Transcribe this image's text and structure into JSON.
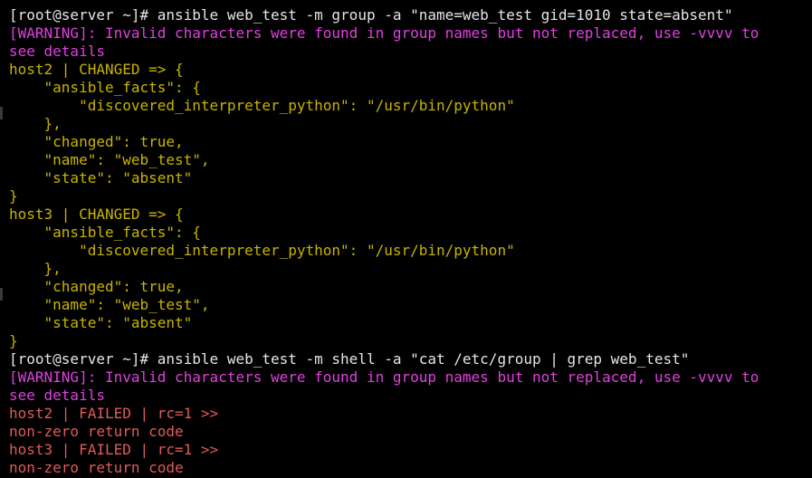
{
  "terminal": {
    "colors": {
      "background": "#000000",
      "prompt": "#e6e6e6",
      "warning": "#e040e0",
      "changed": "#c8b400",
      "failed": "#e05a5a"
    },
    "lines": [
      {
        "kind": "prompt",
        "text": "[root@server ~]# ansible web_test -m group -a \"name=web_test gid=1010 state=absent\""
      },
      {
        "kind": "warn",
        "text": "[WARNING]: Invalid characters were found in group names but not replaced, use -vvvv to"
      },
      {
        "kind": "warn",
        "text": "see details"
      },
      {
        "kind": "changed",
        "text": "host2 | CHANGED => {"
      },
      {
        "kind": "changed",
        "text": "    \"ansible_facts\": {"
      },
      {
        "kind": "changed",
        "text": "        \"discovered_interpreter_python\": \"/usr/bin/python\""
      },
      {
        "kind": "changed",
        "text": "    },"
      },
      {
        "kind": "changed",
        "text": "    \"changed\": true,"
      },
      {
        "kind": "changed",
        "text": "    \"name\": \"web_test\","
      },
      {
        "kind": "changed",
        "text": "    \"state\": \"absent\""
      },
      {
        "kind": "changed",
        "text": "}"
      },
      {
        "kind": "changed",
        "text": "host3 | CHANGED => {"
      },
      {
        "kind": "changed",
        "text": "    \"ansible_facts\": {"
      },
      {
        "kind": "changed",
        "text": "        \"discovered_interpreter_python\": \"/usr/bin/python\""
      },
      {
        "kind": "changed",
        "text": "    },"
      },
      {
        "kind": "changed",
        "text": "    \"changed\": true,"
      },
      {
        "kind": "changed",
        "text": "    \"name\": \"web_test\","
      },
      {
        "kind": "changed",
        "text": "    \"state\": \"absent\""
      },
      {
        "kind": "changed",
        "text": "}"
      },
      {
        "kind": "prompt",
        "text": "[root@server ~]# ansible web_test -m shell -a \"cat /etc/group | grep web_test\""
      },
      {
        "kind": "warn",
        "text": "[WARNING]: Invalid characters were found in group names but not replaced, use -vvvv to"
      },
      {
        "kind": "warn",
        "text": "see details"
      },
      {
        "kind": "failed",
        "text": "host2 | FAILED | rc=1 >>"
      },
      {
        "kind": "failed",
        "text": "non-zero return code"
      },
      {
        "kind": "failed",
        "text": "host3 | FAILED | rc=1 >>"
      },
      {
        "kind": "failed",
        "text": "non-zero return code"
      }
    ]
  }
}
